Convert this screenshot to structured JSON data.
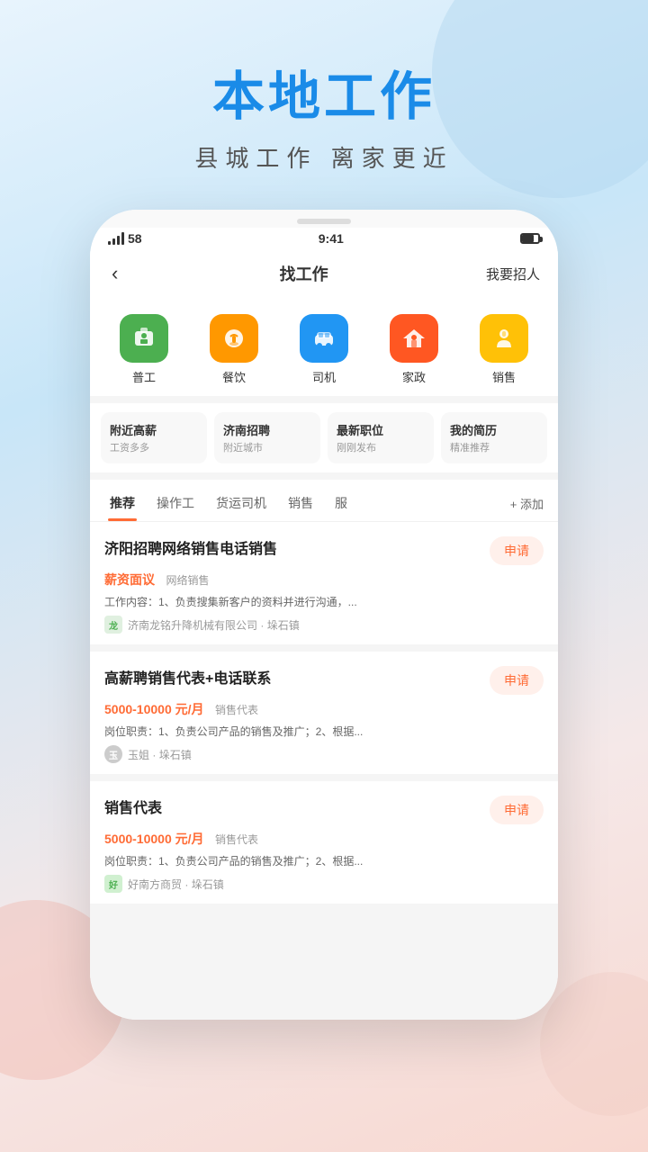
{
  "background": {
    "gradient": "linear-gradient(160deg, #e8f4fd 0%, #c8e6f8 30%, #f5e8e8 70%, #f8d8d0 100%)"
  },
  "hero": {
    "main_title": "本地工作",
    "sub_title": "县城工作  离家更近"
  },
  "status_bar": {
    "signal": "58",
    "time": "9:41",
    "battery": "75"
  },
  "nav": {
    "back_icon": "‹",
    "title": "找工作",
    "right_action": "我要招人"
  },
  "categories": [
    {
      "id": "general",
      "label": "普工",
      "bg": "#4CAF50",
      "icon": "👔"
    },
    {
      "id": "food",
      "label": "餐饮",
      "bg": "#FF9800",
      "icon": "🍽️"
    },
    {
      "id": "driver",
      "label": "司机",
      "bg": "#2196F3",
      "icon": "🚗"
    },
    {
      "id": "housekeep",
      "label": "家政",
      "bg": "#FF5722",
      "icon": "🏠"
    },
    {
      "id": "sales",
      "label": "销售",
      "bg": "#FFC107",
      "icon": "👤"
    }
  ],
  "quick_cards": [
    {
      "title": "附近高薪",
      "sub": "工资多多"
    },
    {
      "title": "济南招聘",
      "sub": "附近城市"
    },
    {
      "title": "最新职位",
      "sub": "刚刚发布"
    },
    {
      "title": "我的简历",
      "sub": "精准推荐"
    }
  ],
  "tabs": [
    {
      "label": "推荐",
      "active": true
    },
    {
      "label": "操作工",
      "active": false
    },
    {
      "label": "货运司机",
      "active": false
    },
    {
      "label": "销售",
      "active": false
    },
    {
      "label": "服",
      "active": false
    }
  ],
  "tab_add": "+ 添加",
  "jobs": [
    {
      "title": "济阳招聘网络销售电话销售",
      "salary": "薪资面议",
      "tag": "网络销售",
      "desc": "工作内容：1、负责搜集新客户的资料并进行沟通，...",
      "company": "济南龙铭升降机械有限公司",
      "location": "垛石镇",
      "apply": "申请",
      "logo_type": "text",
      "logo_text": "龙"
    },
    {
      "title": "高薪聘销售代表+电话联系",
      "salary": "5000-10000 元/月",
      "tag": "销售代表",
      "desc": "岗位职责：1、负责公司产品的销售及推广；2、根据...",
      "company": "玉姐",
      "location": "垛石镇",
      "apply": "申请",
      "logo_type": "avatar",
      "logo_text": "玉"
    },
    {
      "title": "销售代表",
      "salary": "5000-10000 元/月",
      "tag": "销售代表",
      "desc": "岗位职责：1、负责公司产品的销售及推广；2、根据...",
      "company": "好南方商贸",
      "location": "垛石镇",
      "apply": "申请",
      "logo_type": "text",
      "logo_text": "好"
    }
  ]
}
